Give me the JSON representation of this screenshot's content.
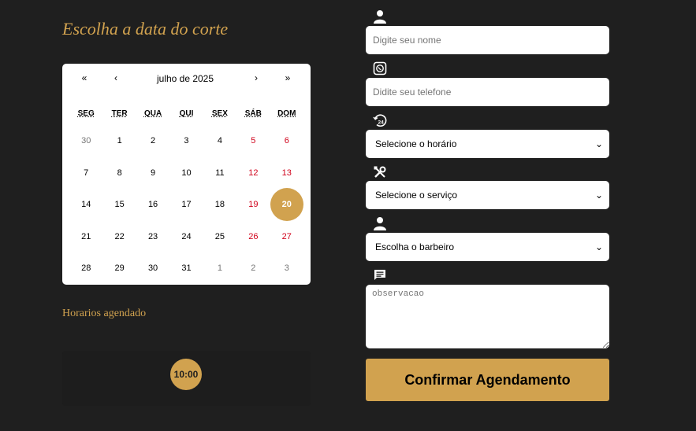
{
  "page": {
    "title": "Escolha a data do corte",
    "scheduled_title": "Horarios agendado"
  },
  "calendar": {
    "nav": {
      "prev_year": "«",
      "prev_month": "‹",
      "next_month": "›",
      "next_year": "»"
    },
    "month_label": "julho de 2025",
    "weekdays": [
      "SEG",
      "TER",
      "QUA",
      "QUI",
      "SEX",
      "SÁB",
      "DOM"
    ],
    "weeks": [
      [
        "30",
        "1",
        "2",
        "3",
        "4",
        "5",
        "6"
      ],
      [
        "7",
        "8",
        "9",
        "10",
        "11",
        "12",
        "13"
      ],
      [
        "14",
        "15",
        "16",
        "17",
        "18",
        "19",
        "20"
      ],
      [
        "21",
        "22",
        "23",
        "24",
        "25",
        "26",
        "27"
      ],
      [
        "28",
        "29",
        "30",
        "31",
        "1",
        "2",
        "3"
      ]
    ],
    "selected_day": "20",
    "accent_color": "#d1a24f",
    "weekend_color": "#d0021b"
  },
  "scheduled_times": [
    "10:00"
  ],
  "form": {
    "name": {
      "icon": "user-icon",
      "placeholder": "Digite seu nome",
      "value": ""
    },
    "phone": {
      "icon": "whatsapp-icon",
      "placeholder": "Didite seu telefone",
      "value": ""
    },
    "time": {
      "icon": "clock-24-icon",
      "selected": "Selecione o horário"
    },
    "service": {
      "icon": "tools-icon",
      "selected": "Selecione o serviço"
    },
    "barber": {
      "icon": "user-icon",
      "selected": "Escolha o barbeiro"
    },
    "notes": {
      "icon": "message-icon",
      "placeholder": "observacao",
      "value": ""
    },
    "confirm_label": "Confirmar Agendamento"
  },
  "colors": {
    "background": "#1f1f1f",
    "accent": "#d1a24f"
  }
}
